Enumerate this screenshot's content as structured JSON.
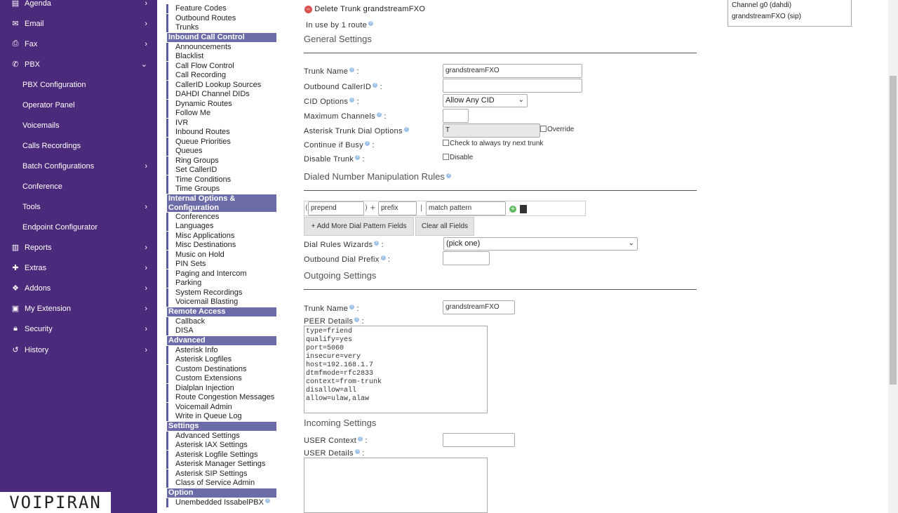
{
  "sidebar": {
    "items": [
      {
        "label": "Agenda",
        "icon": "calendar-icon",
        "chevron": "›"
      },
      {
        "label": "Email",
        "icon": "envelope-icon",
        "chevron": "›"
      },
      {
        "label": "Fax",
        "icon": "printer-icon",
        "chevron": "›"
      },
      {
        "label": "PBX",
        "icon": "phone-icon",
        "chevron": "⌄"
      },
      {
        "label": "PBX Configuration"
      },
      {
        "label": "Operator Panel"
      },
      {
        "label": "Voicemails"
      },
      {
        "label": "Calls Recordings"
      },
      {
        "label": "Batch Configurations",
        "chevron": "›"
      },
      {
        "label": "Conference"
      },
      {
        "label": "Tools",
        "chevron": "›"
      },
      {
        "label": "Endpoint Configurator"
      },
      {
        "label": "Reports",
        "icon": "bar-chart-icon",
        "chevron": "›"
      },
      {
        "label": "Extras",
        "icon": "plus-icon",
        "chevron": "›"
      },
      {
        "label": "Addons",
        "icon": "cubes-icon",
        "chevron": "›"
      },
      {
        "label": "My Extension",
        "icon": "id-card-icon",
        "chevron": "›"
      },
      {
        "label": "Security",
        "icon": "lock-icon",
        "chevron": "›"
      },
      {
        "label": "History",
        "icon": "history-icon",
        "chevron": "›"
      }
    ],
    "logo": "VOIPIRAN"
  },
  "module_menu": {
    "items": [
      "Feature Codes",
      "Outbound Routes",
      "Trunks",
      "Inbound Call Control",
      "Announcements",
      "Blacklist",
      "Call Flow Control",
      "Call Recording",
      "CallerID Lookup Sources",
      "DAHDI Channel DIDs",
      "Dynamic Routes",
      "Follow Me",
      "IVR",
      "Inbound Routes",
      "Queue Priorities",
      "Queues",
      "Ring Groups",
      "Set CallerID",
      "Time Conditions",
      "Time Groups",
      "Internal Options & Configuration",
      "Conferences",
      "Languages",
      "Misc Applications",
      "Misc Destinations",
      "Music on Hold",
      "PIN Sets",
      "Paging and Intercom",
      "Parking",
      "System Recordings",
      "Voicemail Blasting",
      "Remote Access",
      "Callback",
      "DISA",
      "Advanced",
      "Asterisk Info",
      "Asterisk Logfiles",
      "Custom Destinations",
      "Custom Extensions",
      "Dialplan Injection",
      "Route Congestion Messages",
      "Voicemail Admin",
      "Write in Queue Log",
      "Settings",
      "Advanced Settings",
      "Asterisk IAX Settings",
      "Asterisk Logfile Settings",
      "Asterisk Manager Settings",
      "Asterisk SIP Settings",
      "Class of Service Admin",
      "Option",
      "Unembedded IssabelPBX"
    ]
  },
  "trunk_list": [
    "Channel g0 (dahdi)",
    "grandstreamFXO (sip)"
  ],
  "main": {
    "delete_link": "Delete Trunk grandstreamFXO",
    "in_use": "In use by 1 route",
    "general_title": "General Settings",
    "trunk_name_label": "Trunk Name",
    "trunk_name_value": "grandstreamFXO",
    "outbound_callerid_label": "Outbound CallerID",
    "cid_options_label": "CID Options",
    "cid_options_value": "Allow Any CID",
    "max_channels_label": "Maximum Channels",
    "dial_options_label": "Asterisk Trunk Dial Options",
    "dial_options_value": "T",
    "override_label": "Override",
    "continue_busy_label": "Continue if Busy",
    "continue_busy_check": "Check to always try next trunk",
    "disable_trunk_label": "Disable Trunk",
    "disable_check": "Disable",
    "dialed_title": "Dialed Number Manipulation Rules",
    "prepend_placeholder": "prepend",
    "prefix_placeholder": "prefix",
    "match_placeholder": "match pattern",
    "add_more_button": "+ Add More Dial Pattern Fields",
    "clear_all_button": "Clear all Fields",
    "wizards_label": "Dial Rules Wizards",
    "wizards_value": "(pick one)",
    "outbound_prefix_label": "Outbound Dial Prefix",
    "outgoing_title": "Outgoing Settings",
    "outgoing_trunk_name_label": "Trunk Name",
    "outgoing_trunk_name_value": "grandstreamFXO",
    "peer_details_label": "PEER Details",
    "peer_details_value": "type=friend\nqualify=yes\nport=5060\ninsecure=very\nhost=192.168.1.7\ndtmfmode=rfc2833\ncontext=from-trunk\ndisallow=all\nallow=ulaw,alaw",
    "incoming_title": "Incoming Settings",
    "user_context_label": "USER Context",
    "user_details_label": "USER Details"
  },
  "colors": {
    "sidebar_bg": "#4b2a7b",
    "menu_header_bg": "#6c6ca8",
    "delete_icon": "#d9534f"
  }
}
